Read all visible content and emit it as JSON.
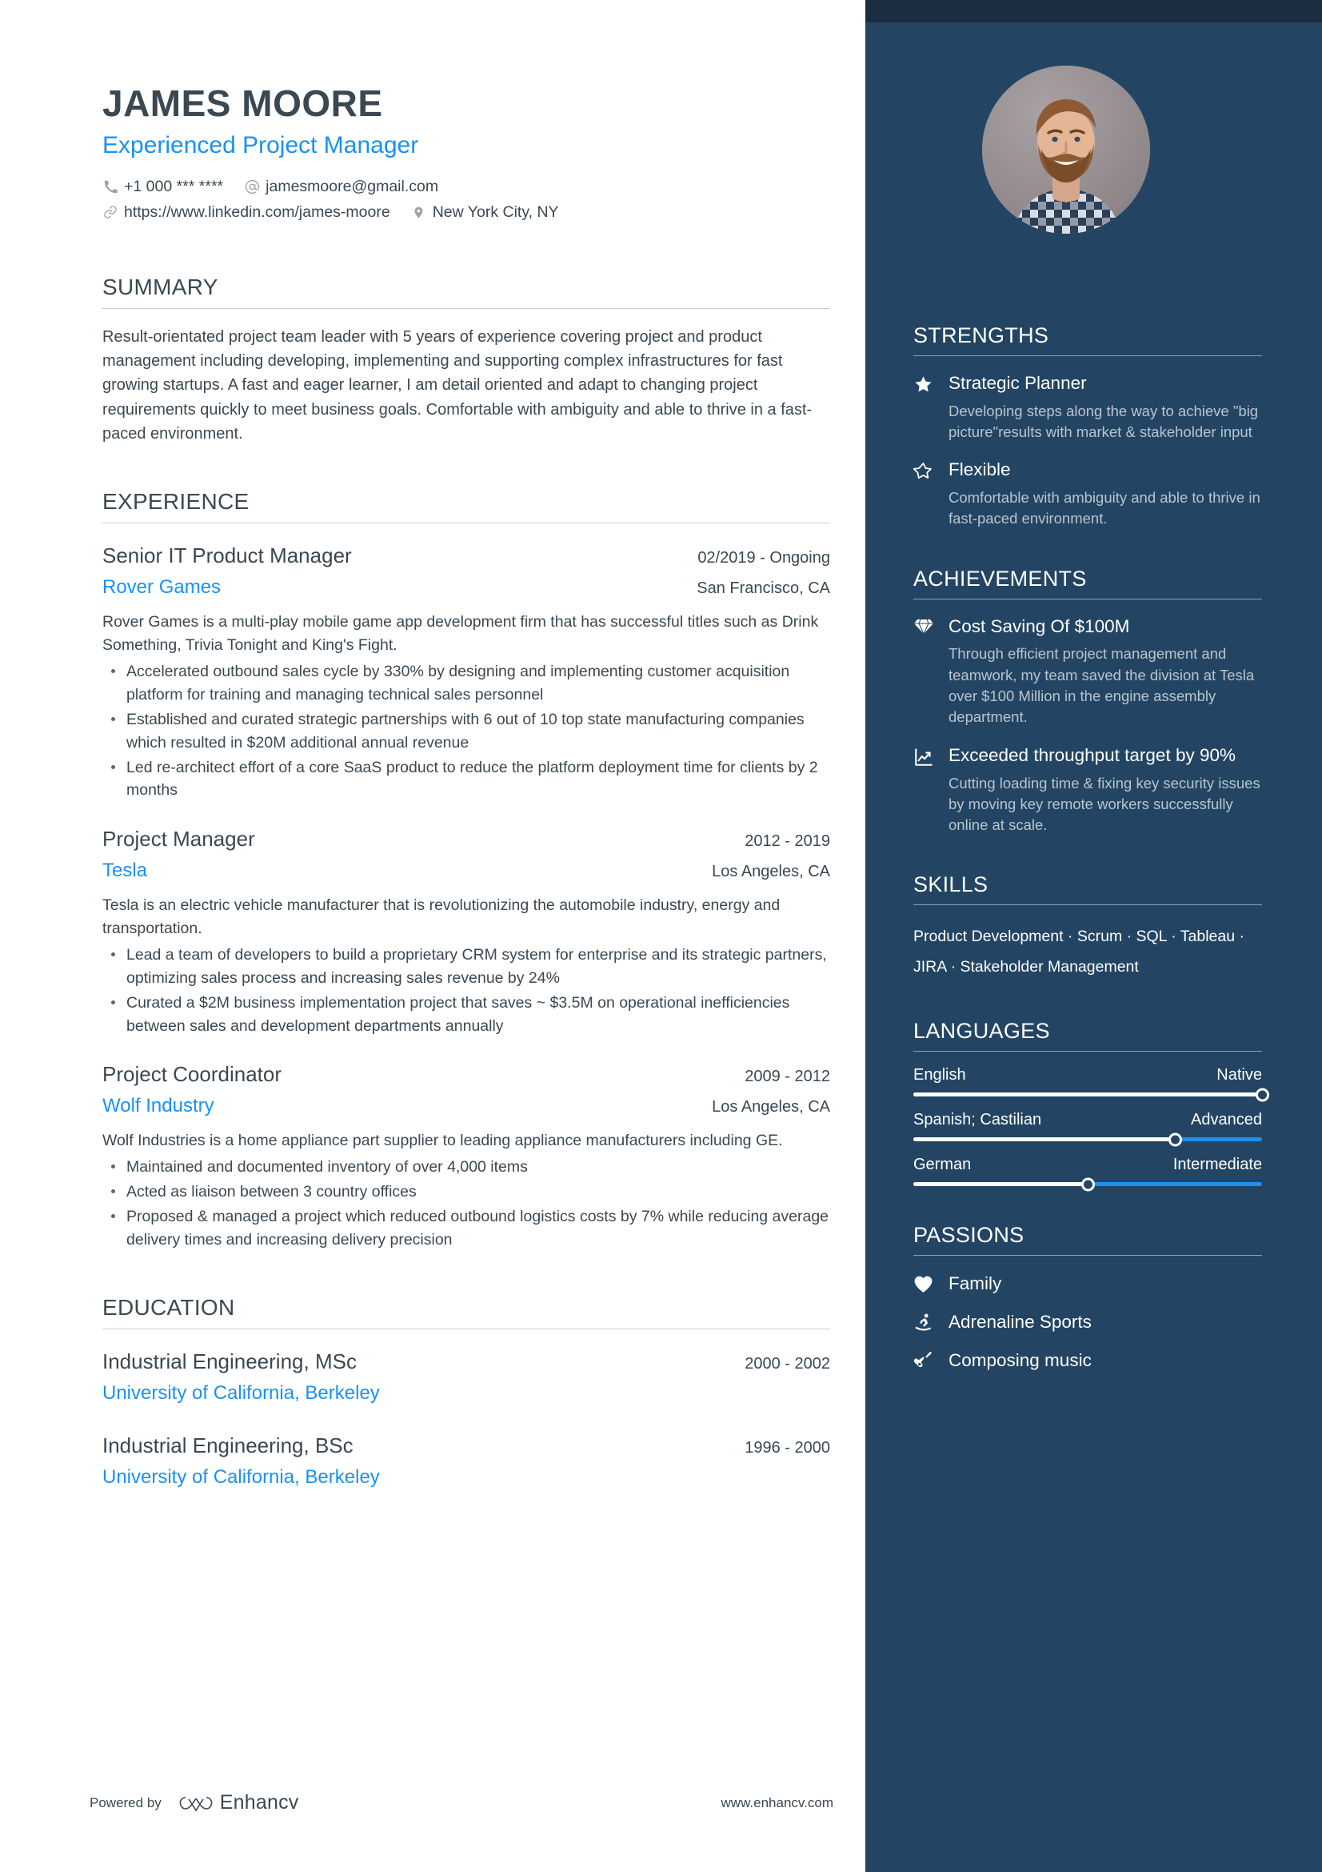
{
  "theme": {
    "accent_blue": "#1a91f0",
    "sidebar_bg": "#234563",
    "sidebar_topband": "#1b2d41",
    "text_dark": "#3b4852",
    "muted_light": "#b9c4cf"
  },
  "header": {
    "name": "JAMES MOORE",
    "job_title": "Experienced Project Manager",
    "contacts": [
      {
        "icon": "phone-icon",
        "text": "+1 000 *** ****"
      },
      {
        "icon": "at-sign-icon",
        "text": "jamesmoore@gmail.com"
      },
      {
        "icon": "link-icon",
        "text": "https://www.linkedin.com/james-moore"
      },
      {
        "icon": "location-pin-icon",
        "text": "New York City, NY"
      }
    ]
  },
  "summary": {
    "title": "SUMMARY",
    "text": "Result-orientated project team leader with 5 years of experience covering project and product management including developing, implementing and supporting complex infrastructures for fast growing startups. A fast and eager learner, I am detail oriented and adapt to changing project requirements quickly to meet business goals. Comfortable with ambiguity and able to thrive in a fast-paced environment."
  },
  "experience": {
    "title": "EXPERIENCE",
    "entries": [
      {
        "role": "Senior IT Product Manager",
        "date": "02/2019 - Ongoing",
        "org": "Rover Games",
        "location": "San Francisco, CA",
        "description": "Rover Games is a multi-play mobile game app development firm that has successful titles such as Drink Something, Trivia Tonight and King's Fight.",
        "bullets": [
          "Accelerated outbound sales cycle by 330% by designing and implementing customer acquisition platform for training and managing technical sales personnel",
          "Established and curated strategic partnerships with 6 out of 10 top state manufacturing companies which resulted in $20M additional annual revenue",
          "Led re-architect effort of a core SaaS product to reduce the platform deployment time for clients by 2 months"
        ]
      },
      {
        "role": "Project Manager",
        "date": "2012 - 2019",
        "org": "Tesla",
        "location": "Los Angeles, CA",
        "description": "Tesla is an electric vehicle manufacturer that is revolutionizing the automobile industry, energy and transportation.",
        "bullets": [
          "Lead a team of developers to build a proprietary CRM system for enterprise and its strategic partners, optimizing sales process and increasing sales revenue by 24%",
          "Curated a $2M business implementation project that saves ~ $3.5M on operational inefficiencies between sales and development departments annually"
        ]
      },
      {
        "role": "Project Coordinator",
        "date": "2009 - 2012",
        "org": "Wolf Industry",
        "location": "Los Angeles, CA",
        "description": "Wolf Industries is a home appliance part supplier to leading appliance manufacturers including GE.",
        "bullets": [
          "Maintained and documented inventory of over 4,000 items",
          "Acted as liaison between 3 country offices",
          "Proposed & managed a project which reduced outbound logistics costs by 7% while reducing average delivery times and increasing delivery precision"
        ]
      }
    ]
  },
  "education": {
    "title": "EDUCATION",
    "entries": [
      {
        "degree": "Industrial Engineering, MSc",
        "date": "2000 - 2002",
        "school": "University of California, Berkeley"
      },
      {
        "degree": "Industrial Engineering, BSc",
        "date": "1996 - 2000",
        "school": "University of California, Berkeley"
      }
    ]
  },
  "footer": {
    "powered_by": "Powered by",
    "brand": "Enhancv",
    "url": "www.enhancv.com"
  },
  "sidebar": {
    "strengths": {
      "title": "STRENGTHS",
      "items": [
        {
          "icon": "star-filled-icon",
          "label": "Strategic Planner",
          "description": "Developing steps along the way to achieve \"big picture\"results with market & stakeholder input"
        },
        {
          "icon": "star-outline-icon",
          "label": "Flexible",
          "description": "Comfortable with ambiguity and able to thrive in fast-paced environment."
        }
      ]
    },
    "achievements": {
      "title": "ACHIEVEMENTS",
      "items": [
        {
          "icon": "diamond-icon",
          "label": "Cost Saving Of $100M",
          "description": "Through efficient project management and teamwork, my team saved the division at Tesla over $100 Million in the engine assembly department."
        },
        {
          "icon": "trending-up-chart-icon",
          "label": "Exceeded throughput target by 90%",
          "description": "Cutting loading time & fixing key security issues by moving key remote workers successfully online at scale."
        }
      ]
    },
    "skills": {
      "title": "SKILLS",
      "text": "Product Development · Scrum · SQL · Tableau · JIRA · Stakeholder Management"
    },
    "languages": {
      "title": "LANGUAGES",
      "items": [
        {
          "name": "English",
          "level": "Native",
          "percent": 100
        },
        {
          "name": "Spanish; Castilian",
          "level": "Advanced",
          "percent": 75
        },
        {
          "name": "German",
          "level": "Intermediate",
          "percent": 50
        }
      ]
    },
    "passions": {
      "title": "PASSIONS",
      "items": [
        {
          "icon": "heart-icon",
          "label": "Family"
        },
        {
          "icon": "snowboarder-icon",
          "label": "Adrenaline Sports"
        },
        {
          "icon": "guitar-icon",
          "label": "Composing music"
        }
      ]
    },
    "avatar": {
      "alt": "profile-photo"
    }
  }
}
